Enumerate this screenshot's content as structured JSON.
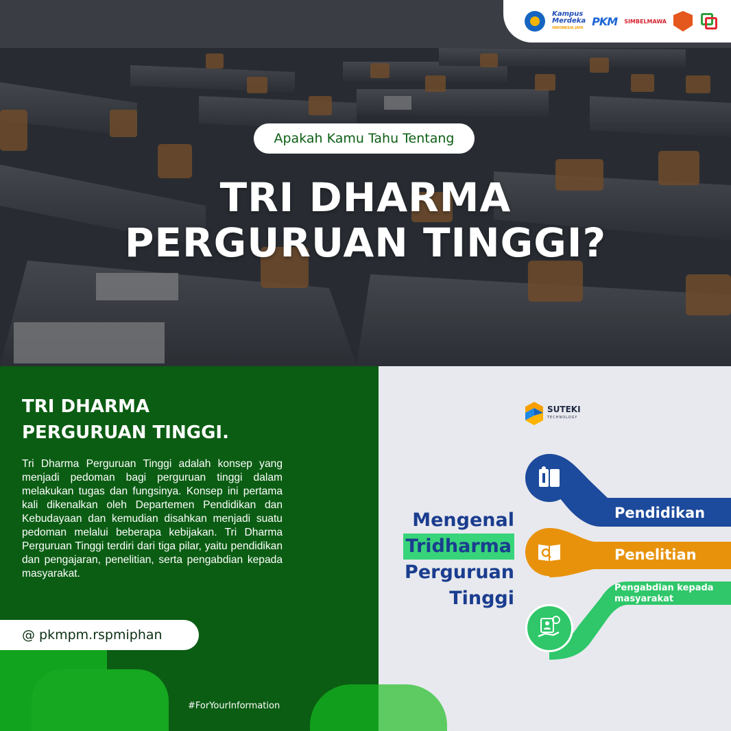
{
  "hero": {
    "kicker": "Apakah Kamu Tahu Tentang",
    "title_line1": "TRI DHARMA",
    "title_line2": "PERGURUAN TINGGI?",
    "logos": {
      "kampus_merdeka_line1": "Kampus",
      "kampus_merdeka_line2": "Merdeka",
      "kampus_merdeka_sub": "INDONESIA JAYA",
      "pkm": "PKM",
      "simbelmawa": "SIMBELMAWA"
    }
  },
  "left": {
    "title_line1": "TRI DHARMA",
    "title_line2": "PERGURUAN TINGGI.",
    "body": "Tri Dharma Perguruan Tinggi adalah konsep yang menjadi pedoman bagi perguruan tinggi dalam melakukan tugas dan fungsinya. Konsep ini pertama kali dikenalkan oleh Departemen Pendidikan dan Kebudayaan dan kemudian disahkan menjadi suatu pedoman melalui beberapa kebijakan. Tri Dharma Perguruan Tinggi terdiri dari tiga pilar, yaitu pendidikan dan pengajaran, penelitian, serta pengabdian kepada masyarakat.",
    "handle": "@ pkmpm.rspmiphan",
    "hashtag": "#ForYourInformation"
  },
  "right": {
    "brand_name": "SUTEKI",
    "brand_sub": "TECHNOLOGY",
    "heading": [
      "Mengenal",
      "Tridharma",
      "Perguruan",
      "Tinggi"
    ],
    "pillars": [
      {
        "label": "Pendidikan",
        "color": "#1c4a9c",
        "icon": "book-icon"
      },
      {
        "label": "Penelitian",
        "color": "#e8920c",
        "icon": "research-book-icon"
      },
      {
        "label": "Pengabdian kepada masyarakat",
        "color": "#2fc76a",
        "icon": "community-service-icon"
      }
    ]
  },
  "colors": {
    "green_dark": "#0b5d13",
    "green_bright": "#11a31e",
    "navy": "#1a3d8f",
    "orange": "#e8920c",
    "teal_green": "#2fc76a"
  }
}
